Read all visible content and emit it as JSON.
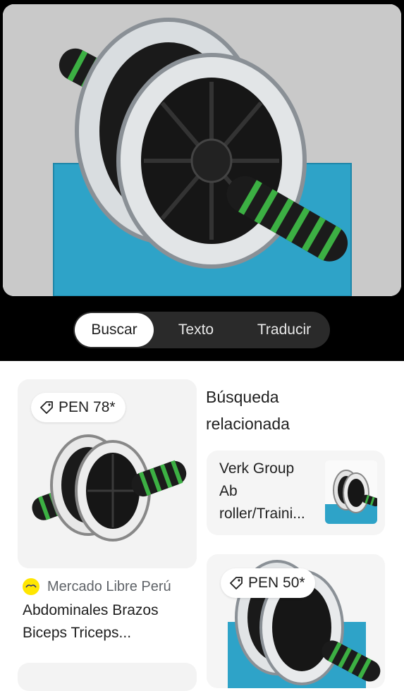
{
  "viewer": {
    "tabs": [
      {
        "label": "Buscar",
        "active": true
      },
      {
        "label": "Texto",
        "active": false
      },
      {
        "label": "Traducir",
        "active": false
      }
    ]
  },
  "results": {
    "main_card": {
      "price": "PEN 78*",
      "source": "Mercado Libre Perú",
      "title_line1": "Abdominales Brazos",
      "title_line2": "Biceps Triceps..."
    },
    "related": {
      "heading_line1": "Búsqueda",
      "heading_line2": "relacionada",
      "card": {
        "line1": "Verk Group",
        "line2": "Ab",
        "line3": "roller/Traini..."
      }
    },
    "second_card": {
      "price": "PEN 50*"
    }
  },
  "colors": {
    "viewer_bg": "#000000",
    "mat_blue": "#2ea3c8",
    "grip_green": "#3cb043",
    "tab_bar": "#2a2a2a",
    "mercado_libre_yellow": "#ffe600"
  }
}
